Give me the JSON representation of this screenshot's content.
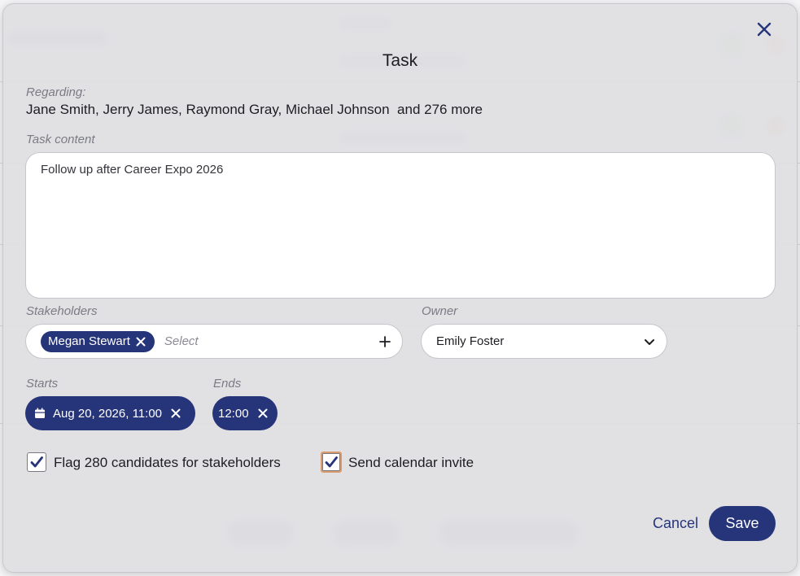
{
  "dialog": {
    "title": "Task",
    "regarding_label": "Regarding:",
    "regarding_names": "Jane Smith, Jerry James, Raymond Gray, Michael Johnson",
    "regarding_more": "and 276 more",
    "task_content_label": "Task content",
    "task_content_value": "Follow up after Career Expo 2026",
    "stakeholders_label": "Stakeholders",
    "stakeholder_chip": "Megan Stewart",
    "stakeholder_placeholder": "Select",
    "owner_label": "Owner",
    "owner_value": "Emily Foster",
    "starts_label": "Starts",
    "starts_value": "Aug 20, 2026, 11:00",
    "ends_label": "Ends",
    "ends_value": "12:00",
    "flag_label": "Flag 280 candidates for stakeholders",
    "flag_checked": true,
    "invite_label": "Send calendar invite",
    "invite_checked": true,
    "cancel_label": "Cancel",
    "save_label": "Save"
  },
  "icons": {
    "close": "close-icon",
    "chip_remove": "x-icon",
    "add": "plus-icon",
    "dropdown": "chevron-down-icon",
    "calendar": "calendar-icon",
    "check": "checkmark-icon"
  },
  "colors": {
    "accent": "#26347a",
    "focus_ring": "#d99a6c"
  }
}
